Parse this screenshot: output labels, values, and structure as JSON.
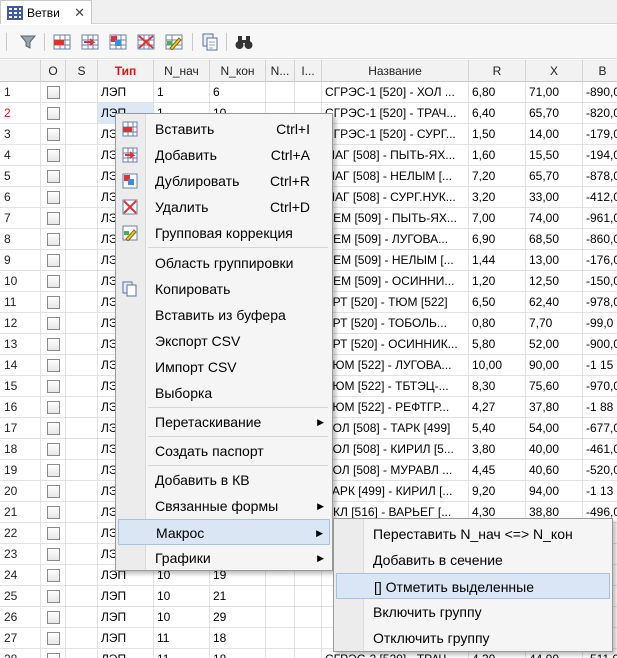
{
  "tab": {
    "title": "Ветви",
    "close": "✕"
  },
  "toolbar": {
    "icons": [
      "filter-icon",
      "insert-row-icon",
      "add-row-icon",
      "duplicate-row-icon",
      "delete-row-icon",
      "group-edit-icon",
      "copy-icon",
      "find-icon"
    ]
  },
  "columns": [
    "",
    "O",
    "S",
    "Тип",
    "N_нач",
    "N_кон",
    "N...",
    "I...",
    "Название",
    "R",
    "X",
    "B"
  ],
  "rows": [
    {
      "n": "1",
      "tip": "ЛЭП",
      "nn": "1",
      "nk": "6",
      "name": "СГРЭС-1 [520] - ХОЛ ...",
      "r": "6,80",
      "x": "71,00",
      "b": "-890,0"
    },
    {
      "n": "2",
      "tip": "ЛЭП",
      "nn": "1",
      "nk": "10",
      "name": "СГРЭС-1 [520] - ТРАЧ...",
      "r": "6,40",
      "x": "65,70",
      "b": "-820,0"
    },
    {
      "n": "3",
      "tip": "ЛЭП",
      "nn": "",
      "nk": "",
      "name": "СГРЭС-1 [520] - СУРГ...",
      "r": "1,50",
      "x": "14,00",
      "b": "-179,0"
    },
    {
      "n": "4",
      "tip": "ЛЭП",
      "nn": "",
      "nk": "",
      "name": "МАГ [508] - ПЫТЬ-ЯХ...",
      "r": "1,60",
      "x": "15,50",
      "b": "-194,0"
    },
    {
      "n": "5",
      "tip": "ЛЭП",
      "nn": "",
      "nk": "",
      "name": "МАГ [508] - НЕЛЫМ [...",
      "r": "7,20",
      "x": "65,70",
      "b": "-878,0"
    },
    {
      "n": "6",
      "tip": "ЛЭП",
      "nn": "",
      "nk": "",
      "name": "МАГ [508] - СУРГ.НУК...",
      "r": "3,20",
      "x": "33,00",
      "b": "-412,0"
    },
    {
      "n": "7",
      "tip": "ЛЭП",
      "nn": "",
      "nk": "",
      "name": "ДЕМ [509] - ПЫТЬ-ЯХ...",
      "r": "7,00",
      "x": "74,00",
      "b": "-961,0"
    },
    {
      "n": "8",
      "tip": "ЛЭП",
      "nn": "",
      "nk": "",
      "name": "ДЕМ [509] - ЛУГОВА...",
      "r": "6,90",
      "x": "68,50",
      "b": "-860,0"
    },
    {
      "n": "9",
      "tip": "ЛЭП",
      "nn": "",
      "nk": "",
      "name": "ДЕМ [509] - НЕЛЫМ [...",
      "r": "1,44",
      "x": "13,00",
      "b": "-176,0"
    },
    {
      "n": "10",
      "tip": "ЛЭП",
      "nn": "",
      "nk": "",
      "name": "ДЕМ [509] - ОСИННИ...",
      "r": "1,20",
      "x": "12,50",
      "b": "-150,0"
    },
    {
      "n": "11",
      "tip": "ЛЭП",
      "nn": "",
      "nk": "",
      "name": "УРТ [520] - ТЮМ [522]",
      "r": "6,50",
      "x": "62,40",
      "b": "-978,0"
    },
    {
      "n": "12",
      "tip": "ЛЭП",
      "nn": "",
      "nk": "",
      "name": "УРТ [520] - ТОБОЛЬ...",
      "r": "0,80",
      "x": "7,70",
      "b": "-99,0"
    },
    {
      "n": "13",
      "tip": "ЛЭП",
      "nn": "",
      "nk": "",
      "name": "УРТ [520] - ОСИННИК...",
      "r": "5,80",
      "x": "52,00",
      "b": "-900,0"
    },
    {
      "n": "14",
      "tip": "ЛЭП",
      "nn": "",
      "nk": "",
      "name": "ТЮМ [522] - ЛУГОВА...",
      "r": "10,00",
      "x": "90,00",
      "b": "-1 15"
    },
    {
      "n": "15",
      "tip": "ЛЭП",
      "nn": "",
      "nk": "",
      "name": "ТЮМ [522] - ТБТЭЦ-...",
      "r": "8,30",
      "x": "75,60",
      "b": "-970,0"
    },
    {
      "n": "16",
      "tip": "ЛЭП",
      "nn": "",
      "nk": "",
      "name": "ТЮМ [522] - РЕФТГР...",
      "r": "4,27",
      "x": "37,80",
      "b": "-1 88"
    },
    {
      "n": "17",
      "tip": "ЛЭП",
      "nn": "",
      "nk": "",
      "name": "ХОЛ [508] - ТАРК [499]",
      "r": "5,40",
      "x": "54,00",
      "b": "-677,0"
    },
    {
      "n": "18",
      "tip": "ЛЭП",
      "nn": "",
      "nk": "",
      "name": "ХОЛ [508] - КИРИЛ [5...",
      "r": "3,80",
      "x": "40,00",
      "b": "-461,0"
    },
    {
      "n": "19",
      "tip": "ЛЭП",
      "nn": "",
      "nk": "",
      "name": "ХОЛ [508] - МУРАВЛ ...",
      "r": "4,45",
      "x": "40,60",
      "b": "-520,0"
    },
    {
      "n": "20",
      "tip": "ЛЭП",
      "nn": "",
      "nk": "",
      "name": "ТАРК [499] - КИРИЛ [...",
      "r": "9,20",
      "x": "94,00",
      "b": "-1 13"
    },
    {
      "n": "21",
      "tip": "ЛЭП",
      "nn": "",
      "nk": "",
      "name": "ЕКЛ [516] - ВАРЬЕГ [...",
      "r": "4,30",
      "x": "38,80",
      "b": "-496,0"
    },
    {
      "n": "22",
      "tip": "ЛЭП",
      "nn": "",
      "nk": "",
      "name": "",
      "r": "",
      "x": "",
      "b": ""
    },
    {
      "n": "23",
      "tip": "ЛЭП",
      "nn": "",
      "nk": "",
      "name": "",
      "r": "",
      "x": "",
      "b": ""
    },
    {
      "n": "24",
      "tip": "ЛЭП",
      "nn": "10",
      "nk": "19",
      "name": "",
      "r": "",
      "x": "",
      "b": ""
    },
    {
      "n": "25",
      "tip": "ЛЭП",
      "nn": "10",
      "nk": "21",
      "name": "",
      "r": "",
      "x": "",
      "b": ""
    },
    {
      "n": "26",
      "tip": "ЛЭП",
      "nn": "10",
      "nk": "29",
      "name": "",
      "r": "",
      "x": "",
      "b": ""
    },
    {
      "n": "27",
      "tip": "ЛЭП",
      "nn": "11",
      "nk": "18",
      "name": "",
      "r": "",
      "x": "",
      "b": ""
    },
    {
      "n": "28",
      "tip": "ЛЭП",
      "nn": "11",
      "nk": "18",
      "name": "СГРЭС-2 [520] - ТРАЧ...",
      "r": "4,30",
      "x": "44,00",
      "b": "-511,0"
    }
  ],
  "context_menu": [
    {
      "label": "Вставить",
      "shortcut": "Ctrl+I",
      "icon": "insert-row-icon"
    },
    {
      "label": "Добавить",
      "shortcut": "Ctrl+A",
      "icon": "add-row-icon"
    },
    {
      "label": "Дублировать",
      "shortcut": "Ctrl+R",
      "icon": "duplicate-row-icon"
    },
    {
      "label": "Удалить",
      "shortcut": "Ctrl+D",
      "icon": "delete-row-icon"
    },
    {
      "label": "Групповая коррекция",
      "shortcut": "",
      "icon": "group-edit-icon"
    },
    {
      "label": "Область группировки",
      "shortcut": "",
      "icon": ""
    },
    {
      "label": "Копировать",
      "shortcut": "",
      "icon": "copy-icon"
    },
    {
      "label": "Вставить из буфера",
      "shortcut": "",
      "icon": ""
    },
    {
      "label": "Экспорт CSV",
      "shortcut": "",
      "icon": ""
    },
    {
      "label": "Импорт CSV",
      "shortcut": "",
      "icon": ""
    },
    {
      "label": "Выборка",
      "shortcut": "",
      "icon": ""
    },
    {
      "label": "Перетаскивание",
      "shortcut": "",
      "icon": "",
      "submenu": true
    },
    {
      "label": "Создать паспорт",
      "shortcut": "",
      "icon": ""
    },
    {
      "label": "Добавить в КВ",
      "shortcut": "",
      "icon": ""
    },
    {
      "label": "Связанные формы",
      "shortcut": "",
      "icon": "",
      "submenu": true
    },
    {
      "label": "Макрос",
      "shortcut": "",
      "icon": "",
      "submenu": true,
      "highlighted": true
    },
    {
      "label": "Графики",
      "shortcut": "",
      "icon": "",
      "submenu": true
    }
  ],
  "macro_submenu": [
    {
      "label": "Переставить N_нач <=> N_кон"
    },
    {
      "label": "Добавить в сечение"
    },
    {
      "label": "[] Отметить выделенные",
      "highlighted": true
    },
    {
      "label": "Включить группу"
    },
    {
      "label": "Отключить группу"
    }
  ],
  "colors": {
    "accent": "#d11111",
    "highlight": "#dbe6f4",
    "menu_bg": "#f5f5f5"
  }
}
